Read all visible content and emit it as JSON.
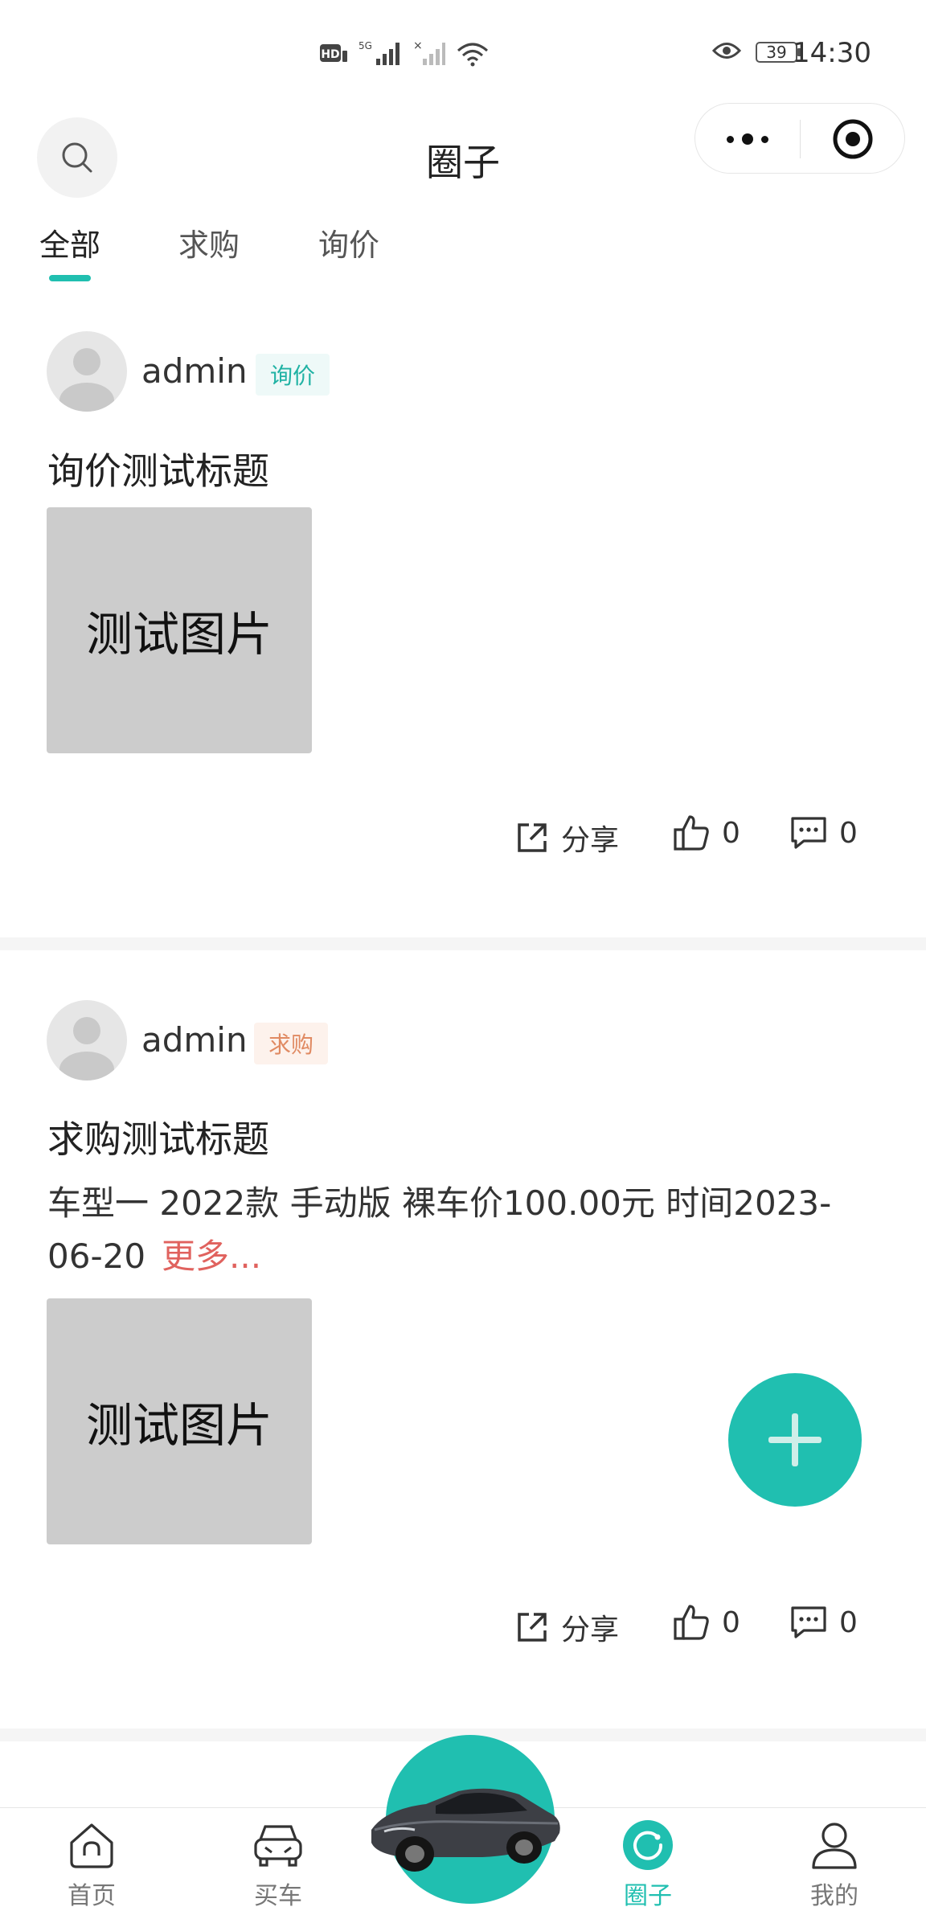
{
  "status_bar": {
    "time": "14:30",
    "battery": "39",
    "network": "5G"
  },
  "header": {
    "title": "圈子"
  },
  "tabs": [
    {
      "label": "全部",
      "active": true
    },
    {
      "label": "求购",
      "active": false
    },
    {
      "label": "询价",
      "active": false
    }
  ],
  "posts": [
    {
      "username": "admin",
      "tag": "询价",
      "title": "询价测试标题",
      "description": "",
      "more": "",
      "image_label": "测试图片",
      "share_label": "分享",
      "likes": "0",
      "comments": "0"
    },
    {
      "username": "admin",
      "tag": "求购",
      "title": "求购测试标题",
      "description": "车型一 2022款 手动版 裸车价100.00元 时间2023-06-20",
      "more": "更多...",
      "image_label": "测试图片",
      "share_label": "分享",
      "likes": "0",
      "comments": "0"
    }
  ],
  "bottom_nav": [
    {
      "label": "首页",
      "icon": "home-icon"
    },
    {
      "label": "买车",
      "icon": "car-front-icon"
    },
    {
      "label": "",
      "icon": "car-photo"
    },
    {
      "label": "圈子",
      "icon": "circle-icon",
      "active": true
    },
    {
      "label": "我的",
      "icon": "user-icon"
    }
  ],
  "colors": {
    "accent": "#20bfb0",
    "inquiry_tag": "#20b2a4",
    "purchase_tag": "#e08a62",
    "more_link": "#e0625e",
    "image_placeholder": "#cccccc"
  }
}
